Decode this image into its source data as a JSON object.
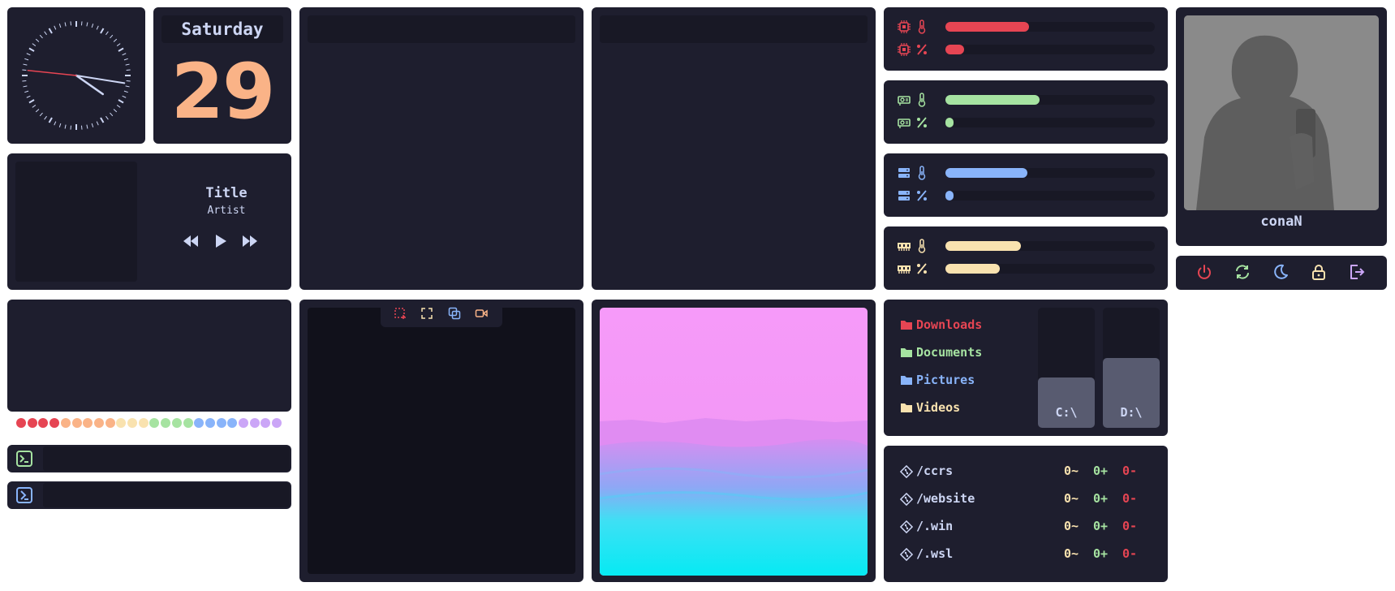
{
  "clock": {
    "hour_deg": 125,
    "minute_deg": 99,
    "second_deg": 276
  },
  "date": {
    "day_name": "Saturday",
    "day_number": "29"
  },
  "music": {
    "title": "Title",
    "artist": "Artist",
    "controls": [
      "rewind-icon",
      "play-icon",
      "fast-forward-icon"
    ]
  },
  "screenshot_toolbar": {
    "icons": [
      "region-select-icon",
      "fullscreen-icon",
      "window-icon",
      "record-icon"
    ]
  },
  "color_dots": [
    "#e64553",
    "#e64553",
    "#e64553",
    "#e64553",
    "#fab387",
    "#fab387",
    "#fab387",
    "#fab387",
    "#fab387",
    "#f9e2af",
    "#f9e2af",
    "#f9e2af",
    "#a6e3a1",
    "#a6e3a1",
    "#a6e3a1",
    "#a6e3a1",
    "#89b4fa",
    "#89b4fa",
    "#89b4fa",
    "#89b4fa",
    "#cba6f7",
    "#cba6f7",
    "#cba6f7",
    "#cba6f7"
  ],
  "terminals": [
    {
      "icon": "terminal-icon",
      "color": "#a6e3a1"
    },
    {
      "icon": "powershell-icon",
      "color": "#89b4fa"
    }
  ],
  "system_bars": [
    {
      "group": "cpu",
      "color": "#e64553",
      "temp_fraction": 0.4,
      "usage_fraction": 0.09
    },
    {
      "group": "gpu",
      "color": "#a6e3a1",
      "temp_fraction": 0.45,
      "usage_fraction": 0.04
    },
    {
      "group": "disk",
      "color": "#89b4fa",
      "temp_fraction": 0.39,
      "usage_fraction": 0.04
    },
    {
      "group": "memory",
      "color": "#f9e2af",
      "temp_fraction": 0.36,
      "usage_fraction": 0.26
    }
  ],
  "folders": [
    {
      "label": "Downloads",
      "color": "#e64553"
    },
    {
      "label": "Documents",
      "color": "#a6e3a1"
    },
    {
      "label": "Pictures",
      "color": "#89b4fa"
    },
    {
      "label": "Videos",
      "color": "#f9e2af"
    }
  ],
  "drives": [
    {
      "label": "C:\\",
      "fill_fraction": 0.42
    },
    {
      "label": "D:\\",
      "fill_fraction": 0.58
    }
  ],
  "git_repos": [
    {
      "path": "/ccrs",
      "modified": "0~",
      "added": "0+",
      "deleted": "0-"
    },
    {
      "path": "/website",
      "modified": "0~",
      "added": "0+",
      "deleted": "0-"
    },
    {
      "path": "/.win",
      "modified": "0~",
      "added": "0+",
      "deleted": "0-"
    },
    {
      "path": "/.wsl",
      "modified": "0~",
      "added": "0+",
      "deleted": "0-"
    }
  ],
  "profile": {
    "username": "conaN"
  },
  "power_buttons": [
    {
      "icon": "power-icon",
      "color": "#e64553"
    },
    {
      "icon": "restart-icon",
      "color": "#a6e3a1"
    },
    {
      "icon": "sleep-icon",
      "color": "#89b4fa"
    },
    {
      "icon": "lock-icon",
      "color": "#f9e2af"
    },
    {
      "icon": "logout-icon",
      "color": "#cba6f7"
    }
  ]
}
